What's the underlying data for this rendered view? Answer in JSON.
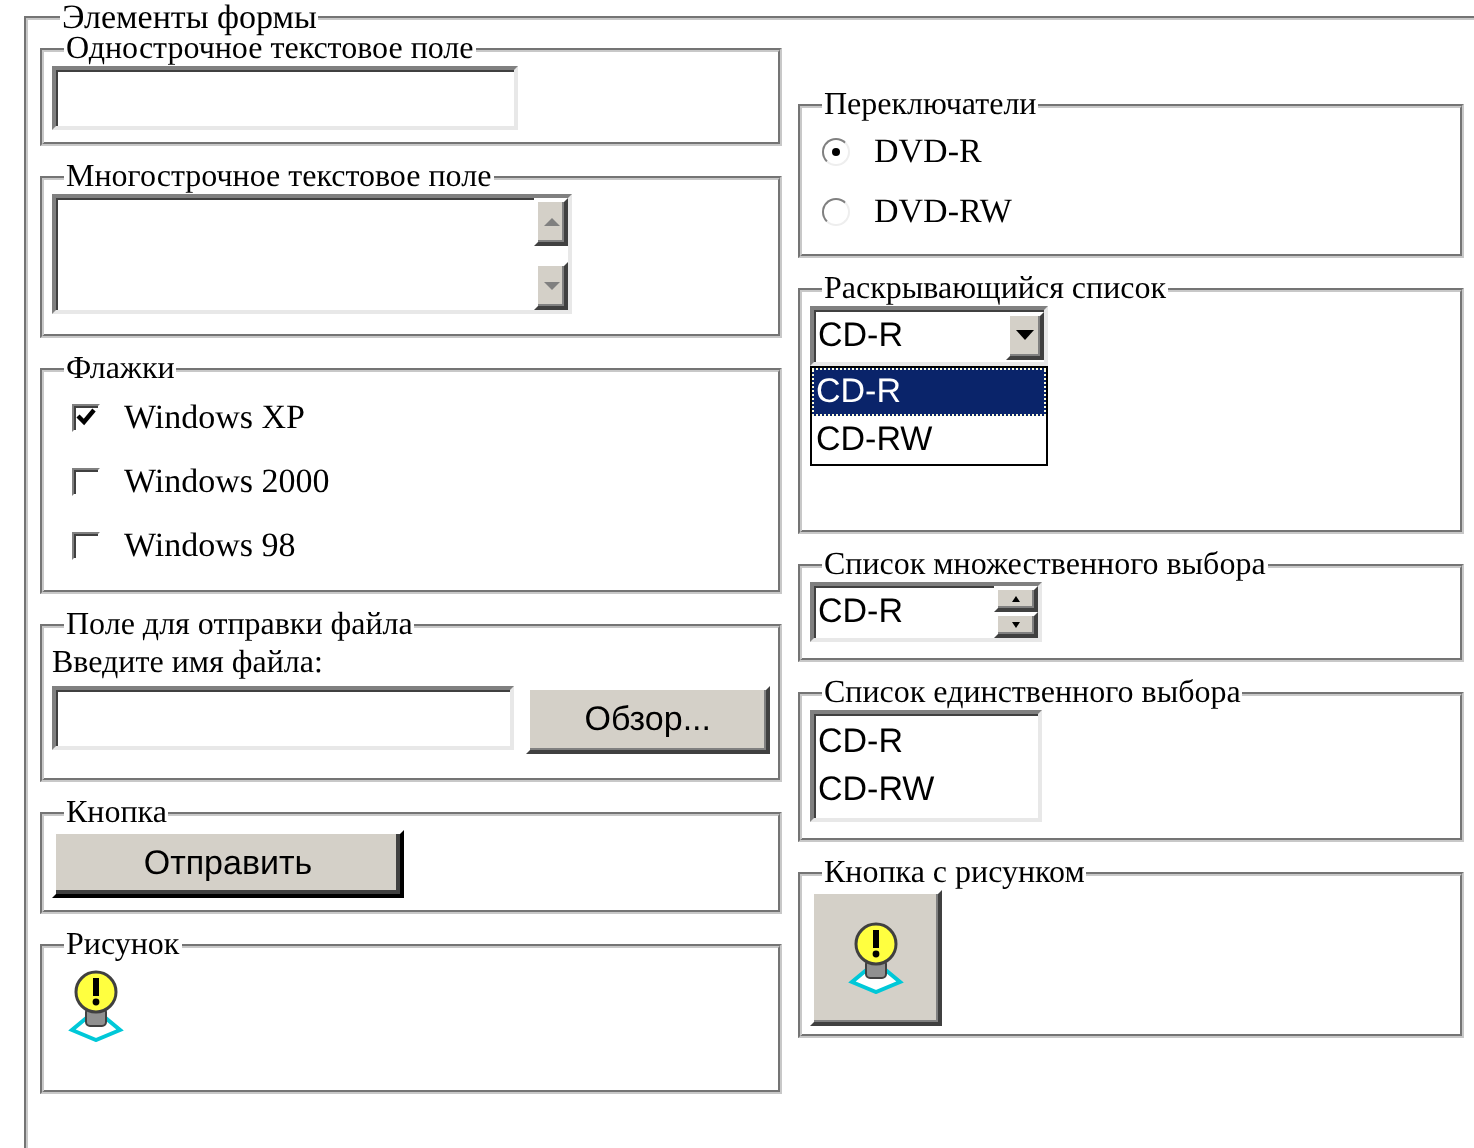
{
  "form": {
    "legend": "Элементы формы"
  },
  "single_line": {
    "legend": "Однострочное текстовое поле"
  },
  "multi_line": {
    "legend": "Многострочное текстовое поле"
  },
  "checkboxes": {
    "legend": "Флажки",
    "items": [
      {
        "label": "Windows XP",
        "checked": true
      },
      {
        "label": "Windows 2000",
        "checked": false
      },
      {
        "label": "Windows 98",
        "checked": false
      }
    ]
  },
  "file_upload": {
    "legend": "Поле для отправки файла",
    "prompt": "Введите имя файла:",
    "browse_button": "Обзор..."
  },
  "button": {
    "legend": "Кнопка",
    "label": "Отправить"
  },
  "image": {
    "legend": "Рисунок"
  },
  "radios": {
    "legend": "Переключатели",
    "items": [
      {
        "label": "DVD-R",
        "selected": true
      },
      {
        "label": "DVD-RW",
        "selected": false
      }
    ]
  },
  "dropdown": {
    "legend": "Раскрывающийся список",
    "value": "CD-R",
    "expanded": true,
    "options": [
      {
        "label": "CD-R",
        "selected": true
      },
      {
        "label": "CD-RW",
        "selected": false
      }
    ]
  },
  "multi_select": {
    "legend": "Список множественного выбора",
    "value": "CD-R"
  },
  "single_select": {
    "legend": "Список единственного выбора",
    "options": [
      {
        "label": "CD-R",
        "selected": false
      },
      {
        "label": "CD-RW",
        "selected": false
      }
    ]
  },
  "image_button": {
    "legend": "Кнопка с рисунком"
  }
}
